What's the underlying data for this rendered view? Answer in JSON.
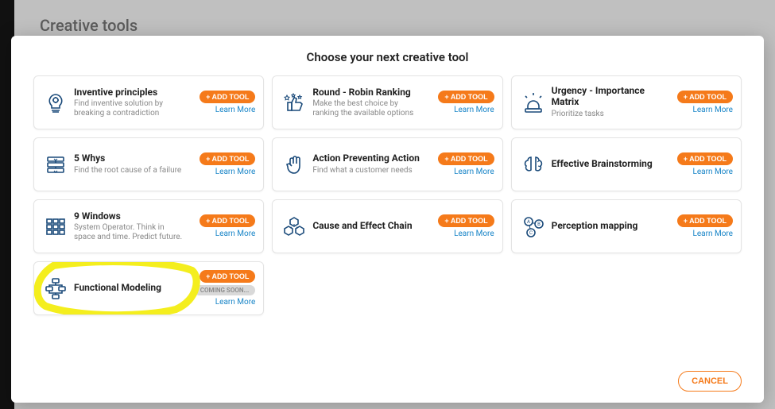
{
  "page": {
    "title": "Creative tools"
  },
  "modal": {
    "title": "Choose your next creative tool",
    "add_label": "+ ADD TOOL",
    "learn_label": "Learn More",
    "coming_soon_label": "COMING SOON...",
    "cancel_label": "CANCEL",
    "tools": [
      {
        "name": "Inventive principles",
        "sub": "Find inventive solution by breaking a contradiction",
        "icon": "lightbulb-gear",
        "highlighted": false,
        "coming_soon": false
      },
      {
        "name": "Round - Robin Ranking",
        "sub": "Make the best choice by ranking the available options",
        "icon": "thumbs-up-stars",
        "highlighted": false,
        "coming_soon": false
      },
      {
        "name": "Urgency - Importance Matrix",
        "sub": "Prioritize tasks",
        "icon": "siren",
        "highlighted": false,
        "coming_soon": false
      },
      {
        "name": "5 Whys",
        "sub": "Find the root cause of a failure",
        "icon": "layers",
        "highlighted": false,
        "coming_soon": false
      },
      {
        "name": "Action Preventing Action",
        "sub": "Find what a customer needs",
        "icon": "hand-stop",
        "highlighted": false,
        "coming_soon": false
      },
      {
        "name": "Effective Brainstorming",
        "sub": "",
        "icon": "brain",
        "highlighted": false,
        "coming_soon": false
      },
      {
        "name": "9 Windows",
        "sub": "System Operator. Think in space and time. Predict future.",
        "icon": "grid3x3",
        "highlighted": false,
        "coming_soon": false
      },
      {
        "name": "Cause and Effect Chain",
        "sub": "",
        "icon": "cubes",
        "highlighted": false,
        "coming_soon": false
      },
      {
        "name": "Perception mapping",
        "sub": "",
        "icon": "abc-nodes",
        "highlighted": false,
        "coming_soon": false
      },
      {
        "name": "Functional Modeling",
        "sub": "",
        "icon": "flowchart",
        "highlighted": true,
        "coming_soon": true
      }
    ]
  },
  "colors": {
    "accent": "#f57a1a",
    "link": "#1784c7",
    "icon": "#1a4a7a",
    "highlight": "#f4ee1e"
  }
}
